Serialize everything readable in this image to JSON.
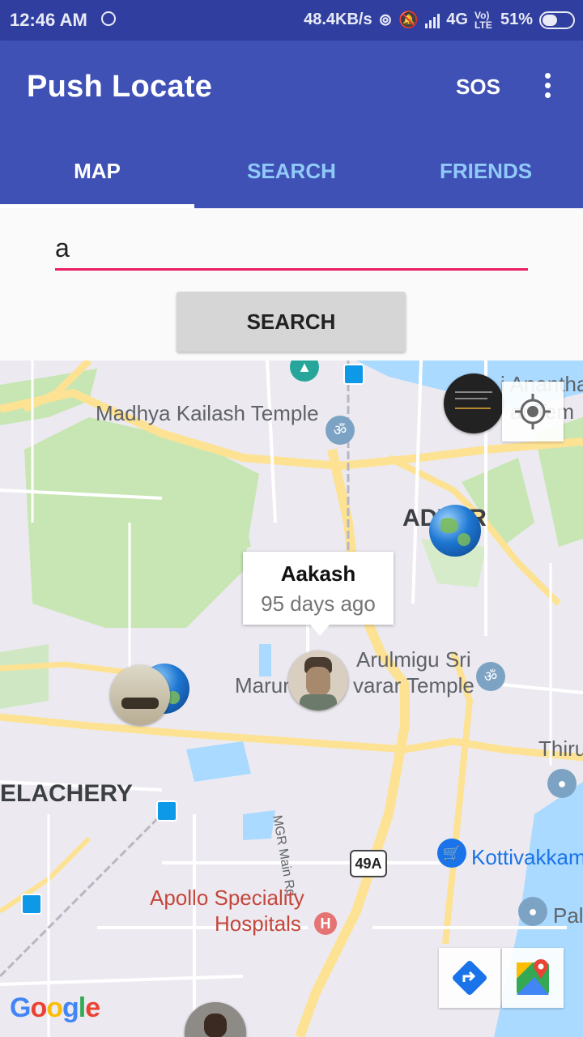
{
  "status": {
    "time": "12:46 AM",
    "speed": "48.4KB/s",
    "network": "4G",
    "volte": "Vo) LTE",
    "battery_text": "51%",
    "battery_level": 0.51
  },
  "appbar": {
    "title": "Push Locate",
    "sos_label": "SOS"
  },
  "tabs": [
    {
      "label": "MAP",
      "active": true
    },
    {
      "label": "SEARCH",
      "active": false
    },
    {
      "label": "FRIENDS",
      "active": false
    }
  ],
  "search": {
    "value": "a",
    "button_label": "SEARCH"
  },
  "map": {
    "labels": {
      "madhya": "Madhya Kailash Temple",
      "anantha": "i Anantha",
      "anantha2": "ar Tem",
      "adyar": "ADYAR",
      "arulmigu": "Arulmigu Sri",
      "marun": "Marun",
      "varar": "varar Temple",
      "thiru": "Thiru",
      "velachery": "ELACHERY",
      "mgr": "MGR Main Rd",
      "highway": "49A",
      "kotti": "Kottivakkam",
      "apollo1": "Apollo Speciality",
      "apollo2": "Hospitals",
      "pal": "Pal",
      "google": "Google"
    },
    "info_window": {
      "name": "Aakash",
      "subtitle": "95 days ago"
    }
  },
  "colors": {
    "primary": "#3f51b5",
    "primary_dark": "#303f9f",
    "accent": "#e91e63",
    "inactive_tab": "#90caf9"
  }
}
